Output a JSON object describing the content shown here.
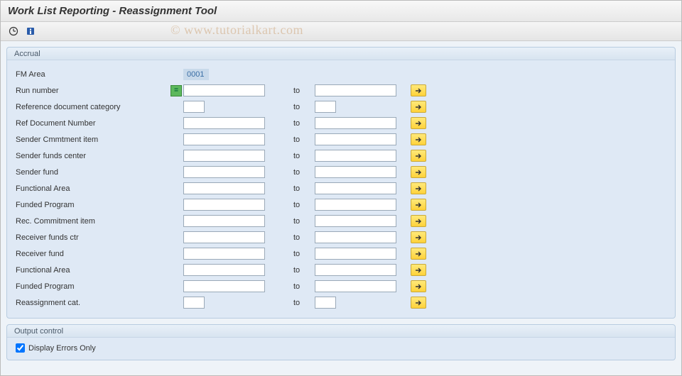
{
  "title": "Work List Reporting - Reassignment Tool",
  "watermark": "© www.tutorialkart.com",
  "group_accrual": {
    "legend": "Accrual",
    "fm_area_label": "FM Area",
    "fm_area_value": "0001",
    "rows": [
      {
        "label": "Run number",
        "from_w": "long",
        "to_w": "long",
        "eq": true
      },
      {
        "label": "Reference document category",
        "from_w": "short",
        "to_w": "short",
        "eq": false
      },
      {
        "label": "Ref Document Number",
        "from_w": "long",
        "to_w": "long",
        "eq": false
      },
      {
        "label": "Sender Cmmtment item",
        "from_w": "long",
        "to_w": "long",
        "eq": false
      },
      {
        "label": "Sender funds center",
        "from_w": "long",
        "to_w": "long",
        "eq": false
      },
      {
        "label": "Sender fund",
        "from_w": "long",
        "to_w": "long",
        "eq": false
      },
      {
        "label": "Functional Area",
        "from_w": "long",
        "to_w": "long",
        "eq": false
      },
      {
        "label": "Funded Program",
        "from_w": "long",
        "to_w": "long",
        "eq": false
      },
      {
        "label": "Rec. Commitment item",
        "from_w": "long",
        "to_w": "long",
        "eq": false
      },
      {
        "label": "Receiver funds ctr",
        "from_w": "long",
        "to_w": "long",
        "eq": false
      },
      {
        "label": "Receiver fund",
        "from_w": "long",
        "to_w": "long",
        "eq": false
      },
      {
        "label": "Functional Area",
        "from_w": "long",
        "to_w": "long",
        "eq": false
      },
      {
        "label": "Funded Program",
        "from_w": "long",
        "to_w": "long",
        "eq": false
      },
      {
        "label": "Reassignment cat.",
        "from_w": "short",
        "to_w": "short",
        "eq": false
      }
    ],
    "to_text": "to"
  },
  "group_output": {
    "legend": "Output control",
    "checkbox_label": "Display Errors Only",
    "checked": true
  }
}
